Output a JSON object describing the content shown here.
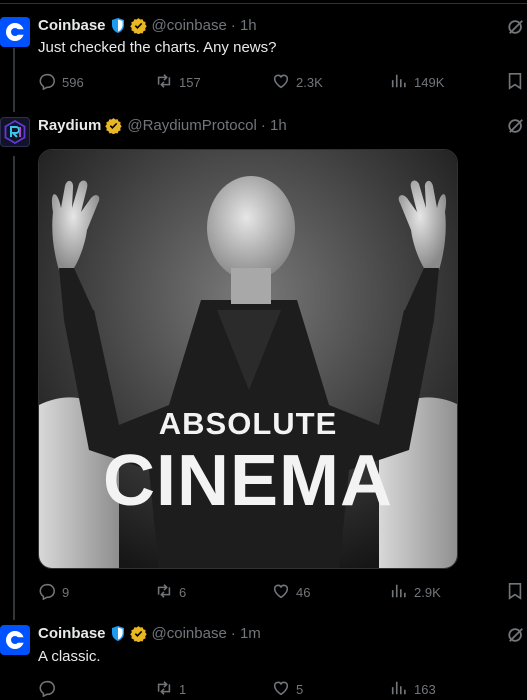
{
  "tweets": [
    {
      "author": "Coinbase",
      "handle": "@coinbase",
      "time": "· 1h",
      "text": "Just checked the charts. Any news?",
      "replies": "596",
      "reposts": "157",
      "likes": "2.3K",
      "views": "149K"
    },
    {
      "author": "Raydium",
      "handle": "@RaydiumProtocol",
      "time": "· 1h",
      "image_caption_line1": "ABSOLUTE",
      "image_caption_line2": "CINEMA",
      "replies": "9",
      "reposts": "6",
      "likes": "46",
      "views": "2.9K"
    },
    {
      "author": "Coinbase",
      "handle": "@coinbase",
      "time": "· 1m",
      "text": "A classic.",
      "replies": "",
      "reposts": "1",
      "likes": "5",
      "views": "163"
    }
  ],
  "colors": {
    "background": "#000000",
    "text": "#e7e9ea",
    "muted": "#71767b",
    "coinbase_blue": "#0052ff",
    "verified_gold": "#e8b723",
    "affiliate_blue": "#1d9bf0"
  },
  "icons": [
    "reply-icon",
    "repost-icon",
    "like-icon",
    "views-icon",
    "bookmark-icon",
    "grok-icon",
    "verified-badge-icon",
    "affiliate-shield-icon"
  ]
}
